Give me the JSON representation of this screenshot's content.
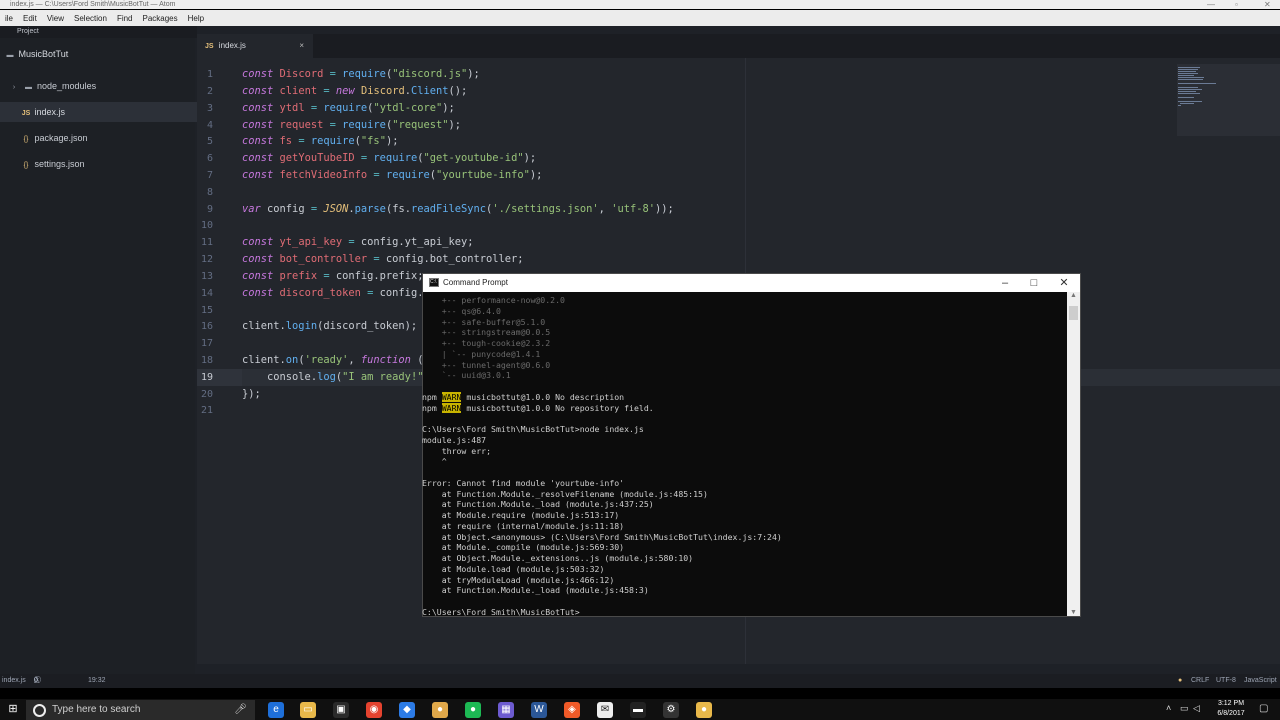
{
  "atom": {
    "title": "index.js — C:\\Users\\Ford Smith\\MusicBotTut — Atom",
    "menu": [
      "ile",
      "Edit",
      "View",
      "Selection",
      "Find",
      "Packages",
      "Help"
    ],
    "tree_header": "Project",
    "tree": [
      {
        "label": "MusicBotTut",
        "icon": "folder-icon"
      },
      {
        "label": "node_modules",
        "icon": "folder-icon"
      },
      {
        "label": "index.js",
        "icon": "js-file-icon",
        "badge": "JS"
      },
      {
        "label": "package.json",
        "icon": "json-file-icon",
        "badge": "{}"
      },
      {
        "label": "settings.json",
        "icon": "json-file-icon",
        "badge": "{}"
      }
    ],
    "tab": {
      "label": "index.js",
      "badge": "JS",
      "close": "×"
    },
    "line_numbers": [
      "1",
      "2",
      "3",
      "4",
      "5",
      "6",
      "7",
      "8",
      "9",
      "10",
      "11",
      "12",
      "13",
      "14",
      "15",
      "16",
      "17",
      "18",
      "19",
      "20",
      "21"
    ],
    "status": {
      "file": "index.js",
      "counts": [
        "0",
        "0",
        "0"
      ],
      "cursor": "19:32",
      "line_ending": "CRLF",
      "encoding": "UTF-8",
      "grammar": "JavaScript"
    }
  },
  "cmd": {
    "title": "Command Prompt",
    "lines": [
      "    +-- performance-now@0.2.0",
      "    +-- qs@6.4.0",
      "    +-- safe-buffer@5.1.0",
      "    +-- stringstream@0.0.5",
      "    +-- tough-cookie@2.3.2",
      "    | `-- punycode@1.4.1",
      "    +-- tunnel-agent@0.6.0",
      "    `-- uuid@3.0.1",
      "",
      "npm WARN musicbottut@1.0.0 No description",
      "npm WARN musicbottut@1.0.0 No repository field.",
      "",
      "C:\\Users\\Ford Smith\\MusicBotTut>node index.js",
      "module.js:487",
      "    throw err;",
      "    ^",
      "",
      "Error: Cannot find module 'yourtube-info'",
      "    at Function.Module._resolveFilename (module.js:485:15)",
      "    at Function.Module._load (module.js:437:25)",
      "    at Module.require (module.js:513:17)",
      "    at require (internal/module.js:11:18)",
      "    at Object.<anonymous> (C:\\Users\\Ford Smith\\MusicBotTut\\index.js:7:24)",
      "    at Module._compile (module.js:569:30)",
      "    at Object.Module._extensions..js (module.js:580:10)",
      "    at Module.load (module.js:503:32)",
      "    at tryModuleLoad (module.js:466:12)",
      "    at Function.Module._load (module.js:458:3)",
      "",
      "C:\\Users\\Ford Smith\\MusicBotTut>"
    ]
  },
  "taskbar": {
    "search_placeholder": "Type here to search",
    "time": "3:12 PM",
    "date": "6/8/2017",
    "icons": [
      "task-view-icon",
      "edge-icon",
      "file-explorer-icon",
      "store-icon",
      "chrome-icon",
      "visual-studio-code-icon",
      "app-icon",
      "spotify-icon",
      "app-icon",
      "word-icon",
      "brave-icon",
      "mail-icon",
      "command-prompt-icon",
      "steam-icon",
      "app-icon"
    ]
  }
}
